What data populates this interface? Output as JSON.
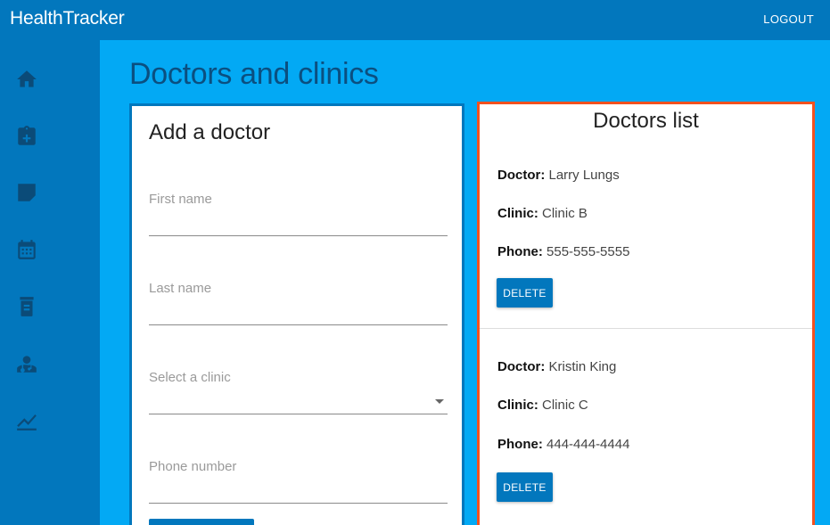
{
  "header": {
    "app_title": "HealthTracker",
    "logout_label": "LOGOUT"
  },
  "sidebar": {
    "items": [
      {
        "icon": "home-icon"
      },
      {
        "icon": "clipboard-plus-icon"
      },
      {
        "icon": "note-icon"
      },
      {
        "icon": "calendar-icon"
      },
      {
        "icon": "pill-bottle-icon"
      },
      {
        "icon": "doctor-icon"
      },
      {
        "icon": "chart-line-icon"
      }
    ]
  },
  "main": {
    "page_title": "Doctors and clinics"
  },
  "add_form": {
    "title": "Add a doctor",
    "first_name_label": "First name",
    "last_name_label": "Last name",
    "clinic_label": "Select a clinic",
    "phone_label": "Phone number"
  },
  "doctors_list": {
    "title": "Doctors list",
    "doctor_prefix": "Doctor:",
    "clinic_prefix": "Clinic:",
    "phone_prefix": "Phone:",
    "delete_label": "DELETE",
    "items": [
      {
        "doctor": "Larry Lungs",
        "clinic": "Clinic B",
        "phone": "555-555-5555"
      },
      {
        "doctor": "Kristin King",
        "clinic": "Clinic C",
        "phone": "444-444-4444"
      }
    ]
  },
  "colors": {
    "primary": "#0277BD",
    "background": "#03A9F4",
    "accent": "#F4511E",
    "icon": "#0B4B78"
  }
}
